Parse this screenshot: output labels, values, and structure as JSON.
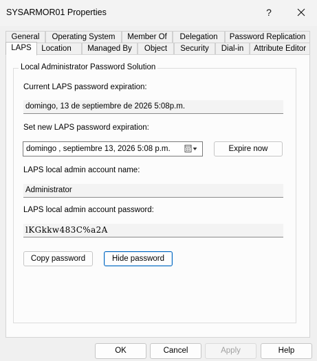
{
  "window": {
    "title": "SYSARMOR01 Properties",
    "help_glyph": "?",
    "close_label": "Close"
  },
  "tabs": {
    "row_top": [
      "General",
      "Operating System",
      "Member Of",
      "Delegation",
      "Password Replication"
    ],
    "row_bottom": [
      "LAPS",
      "Location",
      "Managed By",
      "Object",
      "Security",
      "Dial-in",
      "Attribute Editor"
    ],
    "active": "LAPS"
  },
  "laps": {
    "group_title": "Local Administrator Password Solution",
    "current_expiration_label": "Current LAPS password expiration:",
    "current_expiration_value": "domingo, 13 de septiembre de 2026 5:08p.m.",
    "new_expiration_label": "Set new LAPS password expiration:",
    "new_expiration_value": "domingo , septiembre 13, 2026   5:08 p.m.",
    "expire_now_label": "Expire now",
    "account_name_label": "LAPS local admin account name:",
    "account_name_value": "Administrator",
    "account_password_label": "LAPS local admin account password:",
    "account_password_value": "lKGkkw483C%a2A",
    "copy_password_label": "Copy password",
    "hide_password_label": "Hide password"
  },
  "footer": {
    "ok_label": "OK",
    "cancel_label": "Cancel",
    "apply_label": "Apply",
    "help_label": "Help"
  },
  "colors": {
    "focus_border": "#0067c0",
    "window_bg": "#f0f0f0",
    "panel_bg": "#fcfcfc"
  }
}
